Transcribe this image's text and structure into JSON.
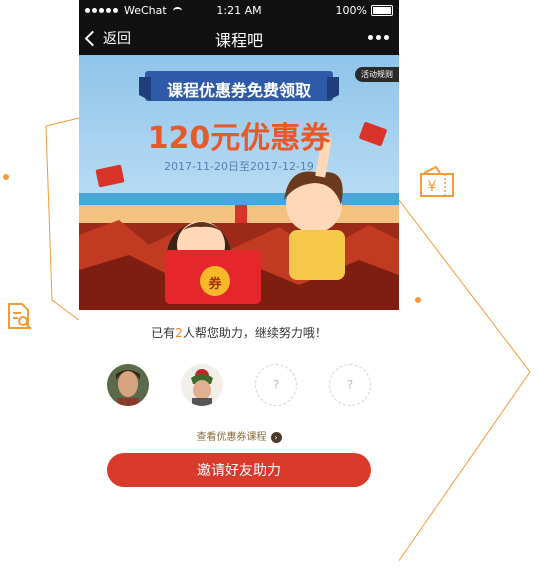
{
  "status_bar": {
    "carrier": "WeChat",
    "time": "1:21 AM",
    "battery": "100%"
  },
  "nav": {
    "back_label": "返回",
    "title": "课程吧"
  },
  "banner": {
    "title": "课程优惠券免费领取",
    "amount": "120元优惠券",
    "date_range": "2017-11-20日至2017-12-19",
    "rules_label": "活动规则",
    "coupon_badge": "券"
  },
  "help": {
    "prefix": "已有",
    "count": "2",
    "suffix": "人帮您助力，继续努力哦！"
  },
  "helpers": [
    {
      "kind": "photo",
      "label": ""
    },
    {
      "kind": "photo",
      "label": ""
    },
    {
      "kind": "empty",
      "label": "?"
    },
    {
      "kind": "empty",
      "label": "?"
    }
  ],
  "links": {
    "view_courses": "查看优惠券课程",
    "arrow": "›"
  },
  "cta": {
    "invite_label": "邀请好友助力"
  },
  "colors": {
    "accent_red": "#d83a2c",
    "accent_orange": "#f2892b",
    "nav_bg": "#111111"
  },
  "icons": {
    "search_document": "search-document-icon",
    "coupon_ticket": "coupon-ticket-icon"
  }
}
